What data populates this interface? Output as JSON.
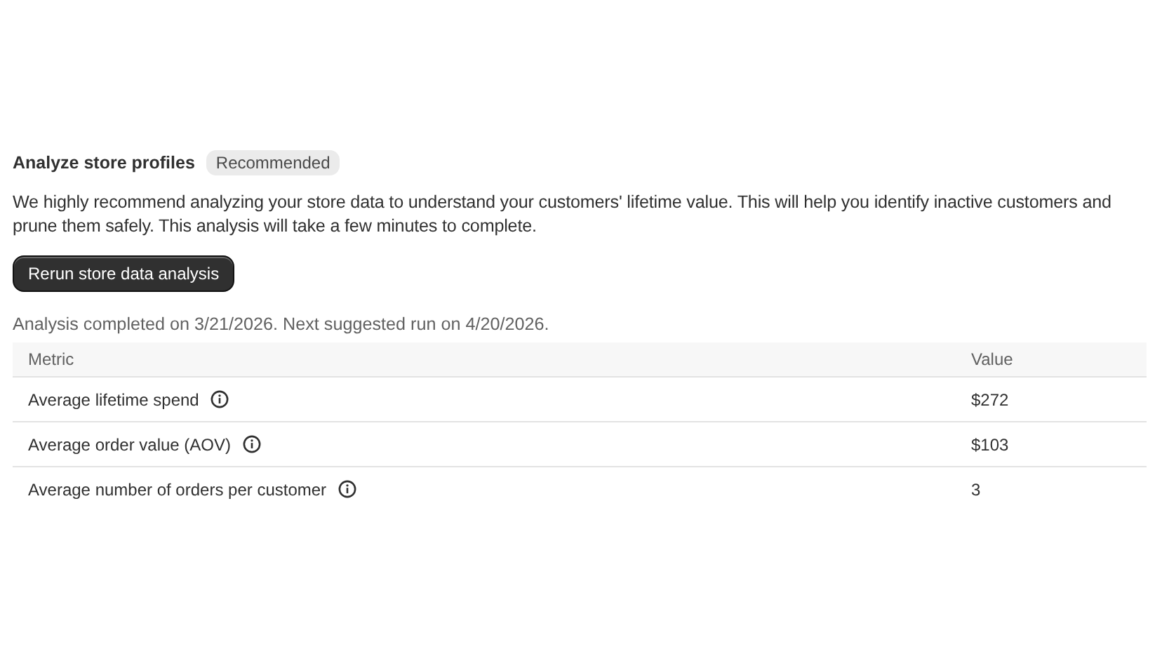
{
  "section": {
    "title": "Analyze store profiles",
    "badge": "Recommended",
    "description": "We highly recommend analyzing your store data to understand your customers' lifetime value. This will help you identify inactive customers and prune them safely. This analysis will take a few minutes to complete.",
    "button": "Rerun store data analysis",
    "status": "Analysis completed on 3/21/2026. Next suggested run on 4/20/2026."
  },
  "table": {
    "columns": [
      "Metric",
      "Value"
    ],
    "rows": [
      {
        "metric": "Average lifetime spend",
        "value": "$272"
      },
      {
        "metric": "Average order value (AOV)",
        "value": "$103"
      },
      {
        "metric": "Average number of orders per customer",
        "value": "3"
      }
    ]
  }
}
